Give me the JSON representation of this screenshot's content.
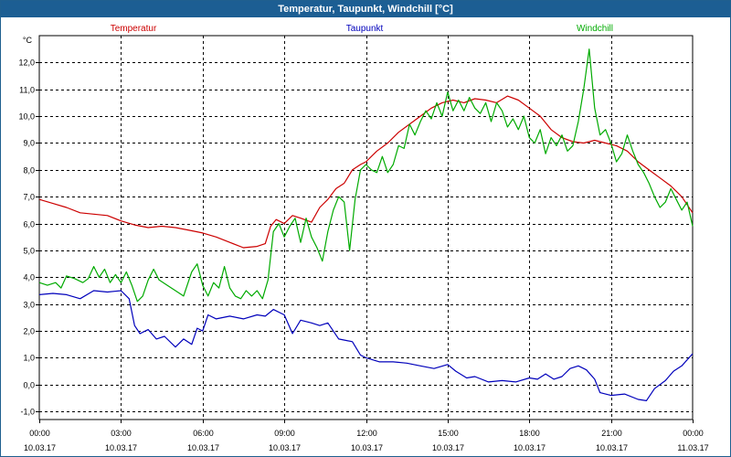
{
  "window": {
    "title": "Temperatur, Taupunkt, Windchill [°C]"
  },
  "chart_data": {
    "type": "line",
    "title": "Temperatur, Taupunkt, Windchill [°C]",
    "ylabel": "°C",
    "ylim": [
      -1.3,
      13.0
    ],
    "xlim": [
      0,
      24
    ],
    "grid": true,
    "legend_position": "top",
    "y_ticks": [
      -1.0,
      0.0,
      1.0,
      2.0,
      3.0,
      4.0,
      5.0,
      6.0,
      7.0,
      8.0,
      9.0,
      10.0,
      11.0,
      12.0
    ],
    "y_tick_labels": [
      "-1,0",
      "0,0",
      "1,0",
      "2,0",
      "3,0",
      "4,0",
      "5,0",
      "6,0",
      "7,0",
      "8,0",
      "9,0",
      "10,0",
      "11,0",
      "12,0"
    ],
    "x_ticks": [
      {
        "h": 0,
        "time": "00:00",
        "date": "10.03.17"
      },
      {
        "h": 3,
        "time": "03:00",
        "date": "10.03.17"
      },
      {
        "h": 6,
        "time": "06:00",
        "date": "10.03.17"
      },
      {
        "h": 9,
        "time": "09:00",
        "date": "10.03.17"
      },
      {
        "h": 12,
        "time": "12:00",
        "date": "10.03.17"
      },
      {
        "h": 15,
        "time": "15:00",
        "date": "10.03.17"
      },
      {
        "h": 18,
        "time": "18:00",
        "date": "10.03.17"
      },
      {
        "h": 21,
        "time": "21:00",
        "date": "10.03.17"
      },
      {
        "h": 24,
        "time": "00:00",
        "date": "11.03.17"
      }
    ],
    "series": [
      {
        "name": "Temperatur",
        "color": "#cc0000",
        "points": [
          [
            0,
            6.9
          ],
          [
            0.5,
            6.75
          ],
          [
            1,
            6.6
          ],
          [
            1.5,
            6.4
          ],
          [
            2,
            6.35
          ],
          [
            2.5,
            6.3
          ],
          [
            3,
            6.1
          ],
          [
            3.5,
            5.95
          ],
          [
            4,
            5.85
          ],
          [
            4.5,
            5.9
          ],
          [
            5,
            5.85
          ],
          [
            5.5,
            5.75
          ],
          [
            6,
            5.65
          ],
          [
            6.5,
            5.5
          ],
          [
            7,
            5.3
          ],
          [
            7.5,
            5.1
          ],
          [
            8,
            5.15
          ],
          [
            8.3,
            5.25
          ],
          [
            8.5,
            5.9
          ],
          [
            8.7,
            6.15
          ],
          [
            9,
            6.0
          ],
          [
            9.3,
            6.3
          ],
          [
            9.6,
            6.2
          ],
          [
            10,
            6.05
          ],
          [
            10.3,
            6.6
          ],
          [
            10.6,
            6.9
          ],
          [
            10.9,
            7.3
          ],
          [
            11.2,
            7.5
          ],
          [
            11.5,
            8.0
          ],
          [
            11.8,
            8.2
          ],
          [
            12,
            8.3
          ],
          [
            12.4,
            8.7
          ],
          [
            12.8,
            9.0
          ],
          [
            13.2,
            9.4
          ],
          [
            13.6,
            9.7
          ],
          [
            14,
            10.0
          ],
          [
            14.4,
            10.3
          ],
          [
            14.8,
            10.5
          ],
          [
            15.2,
            10.6
          ],
          [
            15.6,
            10.5
          ],
          [
            16,
            10.65
          ],
          [
            16.4,
            10.6
          ],
          [
            16.8,
            10.5
          ],
          [
            17.2,
            10.75
          ],
          [
            17.6,
            10.6
          ],
          [
            18,
            10.3
          ],
          [
            18.4,
            10.0
          ],
          [
            18.8,
            9.5
          ],
          [
            19.2,
            9.2
          ],
          [
            19.6,
            9.05
          ],
          [
            20,
            9.0
          ],
          [
            20.4,
            9.1
          ],
          [
            20.8,
            9.0
          ],
          [
            21.2,
            8.9
          ],
          [
            21.6,
            8.7
          ],
          [
            22,
            8.3
          ],
          [
            22.4,
            8.0
          ],
          [
            22.8,
            7.7
          ],
          [
            23.2,
            7.4
          ],
          [
            23.6,
            7.0
          ],
          [
            24,
            6.4
          ]
        ]
      },
      {
        "name": "Taupunkt",
        "color": "#0000bb",
        "points": [
          [
            0,
            3.35
          ],
          [
            0.5,
            3.4
          ],
          [
            1,
            3.35
          ],
          [
            1.5,
            3.2
          ],
          [
            2,
            3.5
          ],
          [
            2.5,
            3.45
          ],
          [
            3,
            3.5
          ],
          [
            3.3,
            3.2
          ],
          [
            3.5,
            2.2
          ],
          [
            3.7,
            1.9
          ],
          [
            4,
            2.05
          ],
          [
            4.3,
            1.7
          ],
          [
            4.6,
            1.8
          ],
          [
            5,
            1.4
          ],
          [
            5.3,
            1.7
          ],
          [
            5.6,
            1.5
          ],
          [
            5.8,
            2.1
          ],
          [
            6,
            2.0
          ],
          [
            6.2,
            2.6
          ],
          [
            6.5,
            2.45
          ],
          [
            7,
            2.55
          ],
          [
            7.5,
            2.45
          ],
          [
            8,
            2.6
          ],
          [
            8.3,
            2.55
          ],
          [
            8.6,
            2.8
          ],
          [
            9,
            2.6
          ],
          [
            9.3,
            1.9
          ],
          [
            9.6,
            2.4
          ],
          [
            10,
            2.3
          ],
          [
            10.3,
            2.2
          ],
          [
            10.6,
            2.3
          ],
          [
            11,
            1.7
          ],
          [
            11.5,
            1.6
          ],
          [
            11.8,
            1.1
          ],
          [
            12,
            1.0
          ],
          [
            12.5,
            0.85
          ],
          [
            13,
            0.85
          ],
          [
            13.5,
            0.8
          ],
          [
            14,
            0.7
          ],
          [
            14.5,
            0.6
          ],
          [
            15,
            0.75
          ],
          [
            15.3,
            0.5
          ],
          [
            15.7,
            0.25
          ],
          [
            16,
            0.3
          ],
          [
            16.5,
            0.1
          ],
          [
            17,
            0.15
          ],
          [
            17.5,
            0.1
          ],
          [
            18,
            0.25
          ],
          [
            18.3,
            0.2
          ],
          [
            18.6,
            0.4
          ],
          [
            18.9,
            0.2
          ],
          [
            19.2,
            0.3
          ],
          [
            19.5,
            0.6
          ],
          [
            19.8,
            0.7
          ],
          [
            20.1,
            0.55
          ],
          [
            20.4,
            0.2
          ],
          [
            20.6,
            -0.3
          ],
          [
            21,
            -0.4
          ],
          [
            21.5,
            -0.35
          ],
          [
            22,
            -0.55
          ],
          [
            22.3,
            -0.6
          ],
          [
            22.6,
            -0.15
          ],
          [
            23,
            0.15
          ],
          [
            23.3,
            0.5
          ],
          [
            23.6,
            0.7
          ],
          [
            24,
            1.15
          ]
        ]
      },
      {
        "name": "Windchill",
        "color": "#00aa00",
        "points": [
          [
            0,
            3.8
          ],
          [
            0.3,
            3.7
          ],
          [
            0.6,
            3.8
          ],
          [
            0.8,
            3.6
          ],
          [
            1,
            4.05
          ],
          [
            1.3,
            3.95
          ],
          [
            1.6,
            3.8
          ],
          [
            1.8,
            3.95
          ],
          [
            2,
            4.4
          ],
          [
            2.2,
            4.0
          ],
          [
            2.4,
            4.3
          ],
          [
            2.6,
            3.8
          ],
          [
            2.8,
            4.1
          ],
          [
            3,
            3.8
          ],
          [
            3.2,
            4.2
          ],
          [
            3.4,
            3.7
          ],
          [
            3.6,
            3.1
          ],
          [
            3.8,
            3.3
          ],
          [
            4,
            3.9
          ],
          [
            4.2,
            4.3
          ],
          [
            4.4,
            3.9
          ],
          [
            4.7,
            3.7
          ],
          [
            5,
            3.5
          ],
          [
            5.3,
            3.3
          ],
          [
            5.6,
            4.2
          ],
          [
            5.8,
            4.5
          ],
          [
            6,
            3.7
          ],
          [
            6.2,
            3.3
          ],
          [
            6.4,
            3.8
          ],
          [
            6.6,
            3.6
          ],
          [
            6.8,
            4.4
          ],
          [
            7,
            3.6
          ],
          [
            7.2,
            3.3
          ],
          [
            7.4,
            3.2
          ],
          [
            7.6,
            3.5
          ],
          [
            7.8,
            3.3
          ],
          [
            8,
            3.5
          ],
          [
            8.2,
            3.2
          ],
          [
            8.4,
            3.9
          ],
          [
            8.6,
            5.7
          ],
          [
            8.8,
            6.0
          ],
          [
            9,
            5.5
          ],
          [
            9.2,
            5.9
          ],
          [
            9.4,
            6.2
          ],
          [
            9.6,
            5.3
          ],
          [
            9.8,
            6.2
          ],
          [
            10,
            5.5
          ],
          [
            10.2,
            5.1
          ],
          [
            10.4,
            4.6
          ],
          [
            10.6,
            5.7
          ],
          [
            10.8,
            6.5
          ],
          [
            11,
            7.0
          ],
          [
            11.2,
            6.8
          ],
          [
            11.4,
            5.0
          ],
          [
            11.6,
            6.9
          ],
          [
            11.8,
            8.0
          ],
          [
            12,
            8.2
          ],
          [
            12.2,
            8.0
          ],
          [
            12.4,
            7.9
          ],
          [
            12.6,
            8.5
          ],
          [
            12.8,
            7.9
          ],
          [
            13,
            8.2
          ],
          [
            13.2,
            8.9
          ],
          [
            13.4,
            8.8
          ],
          [
            13.6,
            9.7
          ],
          [
            13.8,
            9.3
          ],
          [
            14,
            9.8
          ],
          [
            14.2,
            10.2
          ],
          [
            14.4,
            9.9
          ],
          [
            14.6,
            10.5
          ],
          [
            14.8,
            10.0
          ],
          [
            15,
            10.9
          ],
          [
            15.2,
            10.2
          ],
          [
            15.4,
            10.6
          ],
          [
            15.6,
            10.2
          ],
          [
            15.8,
            10.7
          ],
          [
            16,
            10.3
          ],
          [
            16.2,
            10.1
          ],
          [
            16.4,
            10.5
          ],
          [
            16.6,
            9.8
          ],
          [
            16.8,
            10.5
          ],
          [
            17,
            10.2
          ],
          [
            17.2,
            9.6
          ],
          [
            17.4,
            9.9
          ],
          [
            17.6,
            9.5
          ],
          [
            17.8,
            10.0
          ],
          [
            18,
            9.2
          ],
          [
            18.2,
            9.0
          ],
          [
            18.4,
            9.5
          ],
          [
            18.6,
            8.6
          ],
          [
            18.8,
            9.2
          ],
          [
            19,
            8.9
          ],
          [
            19.2,
            9.3
          ],
          [
            19.4,
            8.7
          ],
          [
            19.6,
            8.9
          ],
          [
            19.8,
            9.8
          ],
          [
            20,
            11.0
          ],
          [
            20.2,
            12.5
          ],
          [
            20.4,
            10.3
          ],
          [
            20.6,
            9.3
          ],
          [
            20.8,
            9.5
          ],
          [
            21,
            9.0
          ],
          [
            21.2,
            8.3
          ],
          [
            21.4,
            8.6
          ],
          [
            21.6,
            9.3
          ],
          [
            21.8,
            8.7
          ],
          [
            22,
            8.2
          ],
          [
            22.2,
            7.9
          ],
          [
            22.4,
            7.5
          ],
          [
            22.6,
            7.0
          ],
          [
            22.8,
            6.6
          ],
          [
            23,
            6.8
          ],
          [
            23.2,
            7.3
          ],
          [
            23.4,
            6.9
          ],
          [
            23.6,
            6.5
          ],
          [
            23.8,
            6.8
          ],
          [
            24,
            5.9
          ]
        ]
      }
    ]
  }
}
